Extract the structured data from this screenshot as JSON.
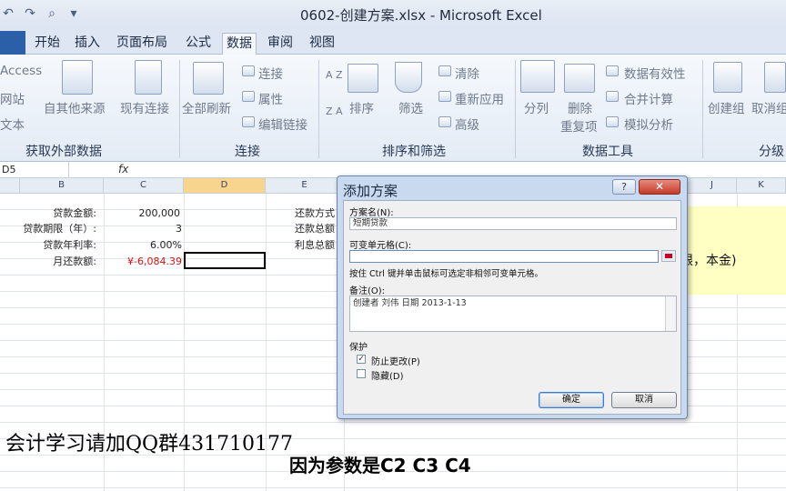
{
  "window": {
    "title": "0602-创建方案.xlsx - Microsoft Excel"
  },
  "qat": {
    "undo": "↶",
    "redo": "↷",
    "preview": "⌕",
    "customize": "▾"
  },
  "tabs": [
    {
      "label": "开始"
    },
    {
      "label": "插入"
    },
    {
      "label": "页面布局"
    },
    {
      "label": "公式"
    },
    {
      "label": "数据"
    },
    {
      "label": "审阅"
    },
    {
      "label": "视图"
    }
  ],
  "ribbon": {
    "external": {
      "access": "Access",
      "web": "网站",
      "text": "文本",
      "other": "自其他来源",
      "existing": "现有连接",
      "group": "获取外部数据"
    },
    "connections": {
      "refresh": "全部刷新",
      "connections": "连接",
      "properties": "属性",
      "edit_links": "编辑链接",
      "group": "连接"
    },
    "sort": {
      "az": "A Z",
      "za": "Z A",
      "sort": "排序",
      "filter": "筛选",
      "clear": "清除",
      "reapply": "重新应用",
      "advanced": "高级",
      "group": "排序和筛选"
    },
    "tools": {
      "split": "分列",
      "remove_dup": "删除\n重复项",
      "remove_dup_1": "删除",
      "remove_dup_2": "重复项",
      "validation": "数据有效性",
      "consolidate": "合并计算",
      "whatif": "模拟分析",
      "group": "数据工具"
    },
    "outline": {
      "group_btn": "创建组",
      "ungroup": "取消组",
      "group": "分级"
    }
  },
  "formula_bar": {
    "namebox": "D5",
    "fx": "fx",
    "value": ""
  },
  "columns": [
    "B",
    "C",
    "D",
    "E",
    "J",
    "K"
  ],
  "sheet": {
    "labels": [
      "贷款金额:",
      "贷款期限（年）:",
      "贷款年利率:",
      "月还款额:"
    ],
    "values": [
      "200,000",
      "3",
      "6.00%",
      "¥-6,084.39"
    ],
    "e_labels": [
      "还款方式",
      "还款总额",
      "利息总额"
    ],
    "yellow_text": "限，本金)"
  },
  "dialog": {
    "title": "添加方案",
    "help": "?",
    "close": "✕",
    "name_label": "方案名(N):",
    "name_value": "短期贷款",
    "cells_label": "可变单元格(C):",
    "cells_value": "",
    "hint": "按住 Ctrl 键并单击鼠标可选定非相邻可变单元格。",
    "comment_label": "备注(O):",
    "comment_value": "创建者 刘伟 日期 2013-1-13",
    "protect_label": "保护",
    "prevent_changes": "防止更改(P)",
    "prevent_checked": true,
    "hide": "隐藏(D)",
    "hide_checked": false,
    "ok": "确定",
    "cancel": "取消"
  },
  "overlay": {
    "qq": "会计学习请加QQ群431710177",
    "caption": "因为参数是C2 C3 C4"
  }
}
